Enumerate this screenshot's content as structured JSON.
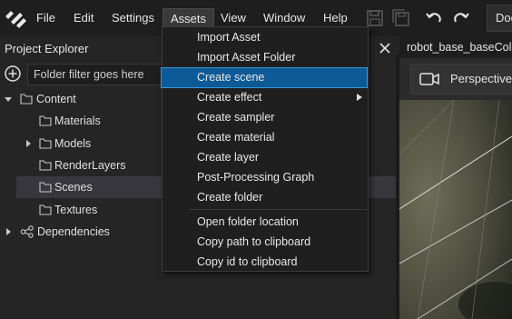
{
  "menubar": {
    "items": [
      "File",
      "Edit",
      "Settings",
      "Assets",
      "View",
      "Window",
      "Help"
    ],
    "active_item": "Assets",
    "doc_button": "Doc"
  },
  "explorer": {
    "title": "Project Explorer",
    "filter_placeholder": "Folder filter goes here",
    "tree": [
      {
        "label": "Content",
        "expanded": true
      },
      {
        "label": "Materials"
      },
      {
        "label": "Models",
        "collapsed": true
      },
      {
        "label": "RenderLayers"
      },
      {
        "label": "Scenes",
        "selected": true
      },
      {
        "label": "Textures"
      },
      {
        "label": "Dependencies",
        "collapsed": true
      }
    ]
  },
  "viewport": {
    "tab_title": "robot_base_baseColo",
    "camera_mode": "Perspective"
  },
  "assets_menu": {
    "items": [
      "Import Asset",
      "Import Asset Folder",
      "Create scene",
      "Create effect",
      "Create sampler",
      "Create material",
      "Create layer",
      "Post-Processing Graph",
      "Create folder",
      "Open folder location",
      "Copy path to clipboard",
      "Copy id to clipboard"
    ],
    "highlighted": "Create scene",
    "submenu_item": "Create effect"
  },
  "colors": {
    "highlight": "#0d5a96",
    "background": "#252526",
    "menubar": "#1e1e1e"
  }
}
